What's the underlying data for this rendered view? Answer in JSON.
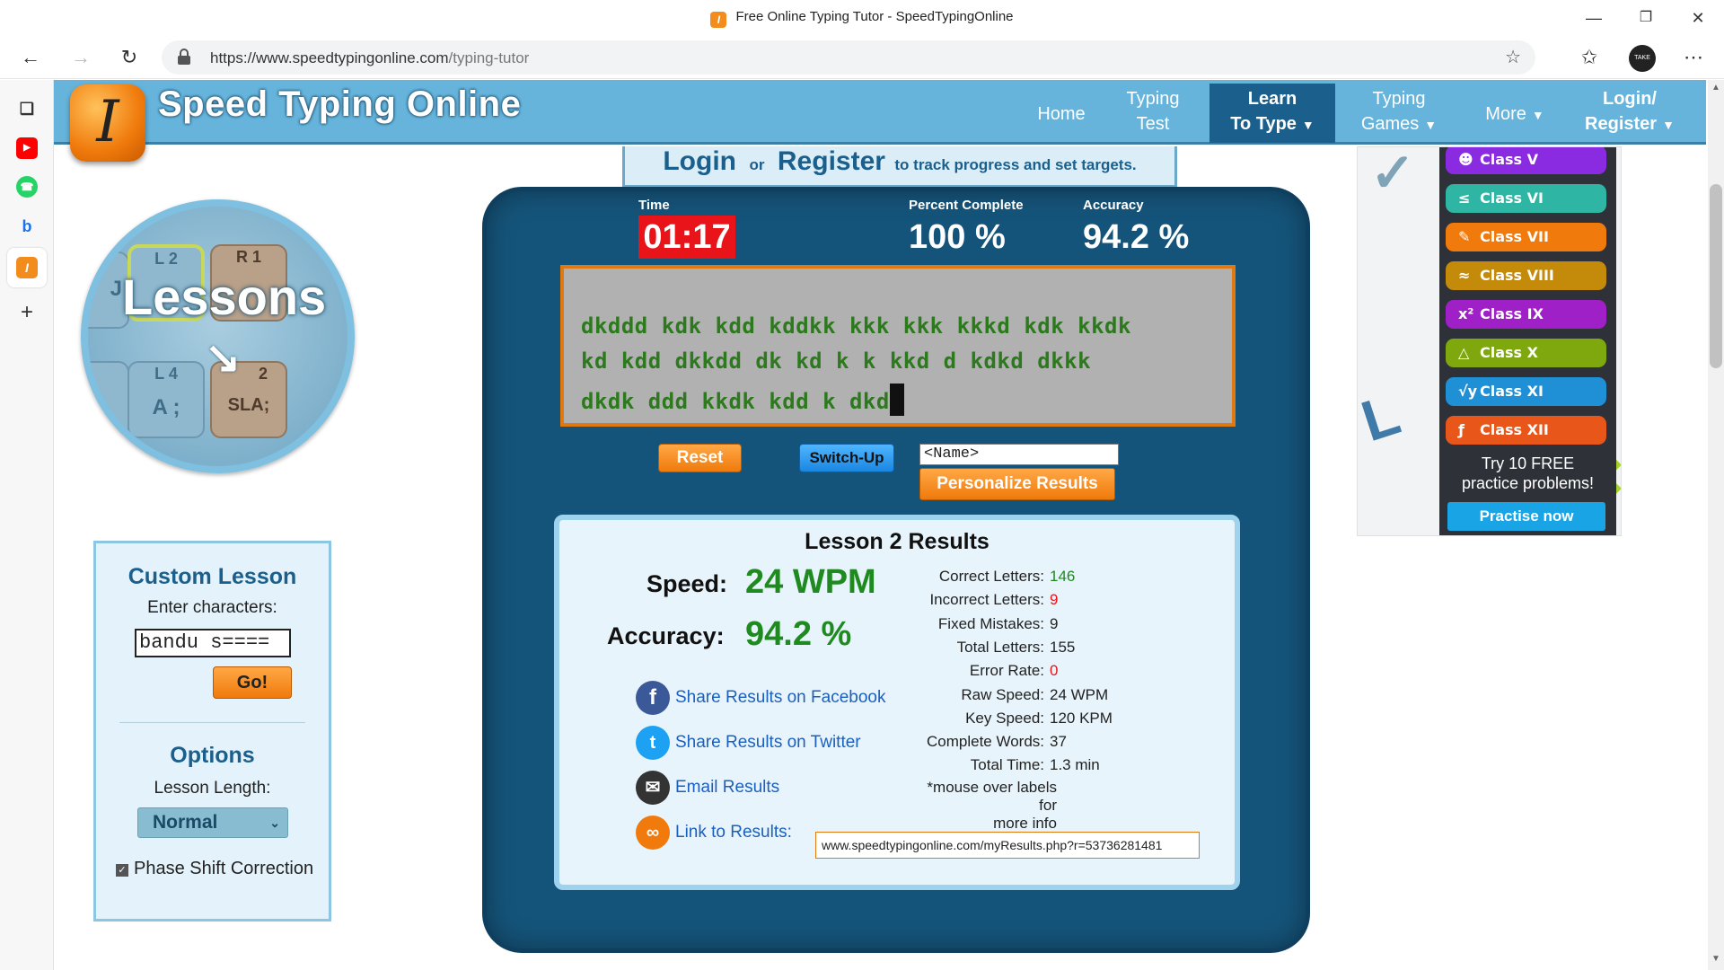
{
  "browser": {
    "tab_title": "Free Online Typing Tutor - SpeedTypingOnline",
    "url_host": "https://www.speedtypingonline.com",
    "url_path": "/typing-tutor"
  },
  "site": {
    "name": "Speed Typing Online",
    "nav": {
      "home": "Home",
      "typing_test_1": "Typing",
      "typing_test_2": "Test",
      "learn_1": "Learn",
      "learn_2": "To Type",
      "games_1": "Typing",
      "games_2": "Games",
      "more": "More",
      "login_1": "Login/",
      "login_2": "Register"
    }
  },
  "login_strip": {
    "login": "Login",
    "or": "or",
    "register": "Register",
    "tail": "to track progress and set targets."
  },
  "lessons_badge": {
    "word": "Lessons",
    "keys": [
      "L 2",
      "R 1",
      "L 4",
      "A ;",
      "2",
      "SLA;",
      "J"
    ]
  },
  "custom_lesson": {
    "title": "Custom Lesson",
    "subtitle": "Enter characters:",
    "input_value": "bandu s====",
    "go": "Go!",
    "options_title": "Options",
    "length_label": "Lesson Length:",
    "length_value": "Normal",
    "phase_shift": "Phase Shift Correction",
    "phase_shift_checked": true
  },
  "stats": {
    "time_label": "Time",
    "time_value": "01:17",
    "percent_label": "Percent Complete",
    "percent_value": "100 %",
    "accuracy_label": "Accuracy",
    "accuracy_value": "94.2 %"
  },
  "typing_text": {
    "line1": "dkddd kdk kdd kddkk kkk kkk kkkd kdk kkdk",
    "line2": "kd kdd dkkdd dk kd k k kkd d kdkd dkkk",
    "line3": "dkdk ddd kkdk kdd k dkd"
  },
  "controls": {
    "reset": "Reset",
    "switch_up": "Switch-Up",
    "name_value": "<Name>",
    "personalize": "Personalize Results"
  },
  "results": {
    "title": "Lesson 2 Results",
    "speed_label": "Speed:",
    "speed_value": "24 WPM",
    "accuracy_label": "Accuracy:",
    "accuracy_value": "94.2 %",
    "share_facebook": "Share Results on Facebook",
    "share_twitter": "Share Results on Twitter",
    "email": "Email Results",
    "link_label": "Link to Results:",
    "link_value": "www.speedtypingonline.com/myResults.php?r=53736281481",
    "rows": [
      {
        "k": "Correct Letters:",
        "v": "146",
        "color": "#1f8a1f"
      },
      {
        "k": "Incorrect Letters:",
        "v": "9",
        "color": "#e8141a"
      },
      {
        "k": "Fixed Mistakes:",
        "v": "9",
        "color": "#222222"
      },
      {
        "k": "Total Letters:",
        "v": "155",
        "color": "#222222"
      },
      {
        "k": "Error Rate:",
        "v": "0",
        "color": "#e8141a"
      },
      {
        "k": "Raw Speed:",
        "v": "24 WPM",
        "color": "#222222"
      },
      {
        "k": "Key Speed:",
        "v": "120 KPM",
        "color": "#222222"
      },
      {
        "k": "Complete Words:",
        "v": "37",
        "color": "#222222"
      },
      {
        "k": "Total Time:",
        "v": "1.3 min",
        "color": "#222222"
      }
    ],
    "note_1": "*mouse over labels for",
    "note_2": "more info"
  },
  "ad": {
    "classes": [
      {
        "label": "Class V",
        "glyph": "☻",
        "color": "#8a2be2"
      },
      {
        "label": "Class VI",
        "glyph": "≤",
        "color": "#2fb5a3"
      },
      {
        "label": "Class VII",
        "glyph": "✎",
        "color": "#f07a0c"
      },
      {
        "label": "Class VIII",
        "glyph": "≈",
        "color": "#c48a0a"
      },
      {
        "label": "Class IX",
        "glyph": "x²",
        "color": "#a020c8"
      },
      {
        "label": "Class X",
        "glyph": "△",
        "color": "#7ea80e"
      },
      {
        "label": "Class XI",
        "glyph": "√y",
        "color": "#1f8fd6"
      },
      {
        "label": "Class XII",
        "glyph": "ƒ",
        "color": "#e8561a"
      }
    ],
    "try_1": "Try 10 FREE",
    "try_2": "practice problems!",
    "practise": "Practise now"
  },
  "colors": {
    "header": "#66b4dc",
    "panel": "#15547a",
    "accent_orange": "#f07a0c",
    "timer_red": "#e8141a",
    "result_green": "#1f8a1f"
  },
  "icons": {
    "back": "arrow-left-icon",
    "forward": "arrow-right-icon",
    "reload": "reload-icon",
    "lock": "lock-icon",
    "favorites_add": "star-plus-icon",
    "favorites": "favorites-icon",
    "menu": "more-icon"
  }
}
